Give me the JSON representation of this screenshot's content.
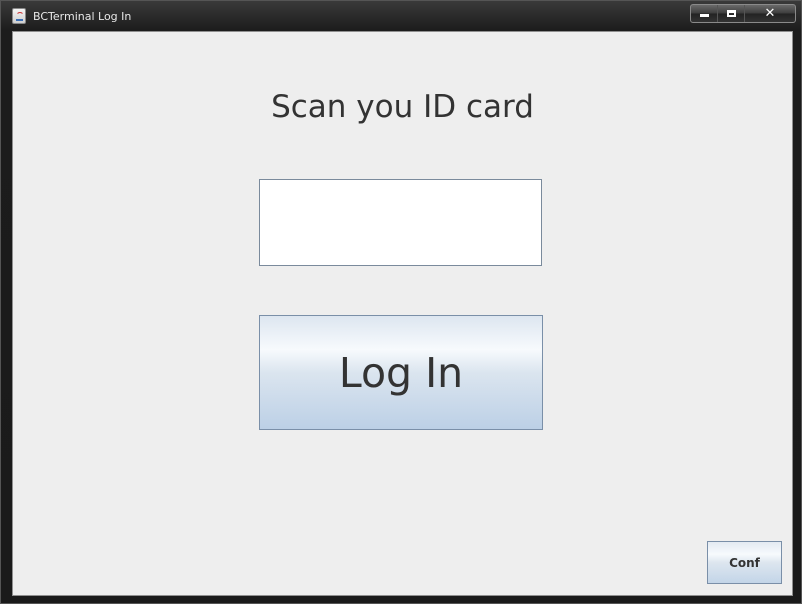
{
  "window": {
    "title": "BCTerminal Log In",
    "app_icon": "java-cup-icon",
    "controls": {
      "minimize_icon": "minimize-icon",
      "maximize_icon": "maximize-icon",
      "close_label": "✕"
    }
  },
  "main": {
    "heading": "Scan you ID card",
    "id_input": {
      "value": "",
      "placeholder": ""
    },
    "login_label": "Log In",
    "conf_label": "Conf"
  },
  "colors": {
    "background": "#eeeeee",
    "button_top": "#f7fafd",
    "button_bottom": "#bcd0e6",
    "button_border": "#7a8fa8"
  }
}
